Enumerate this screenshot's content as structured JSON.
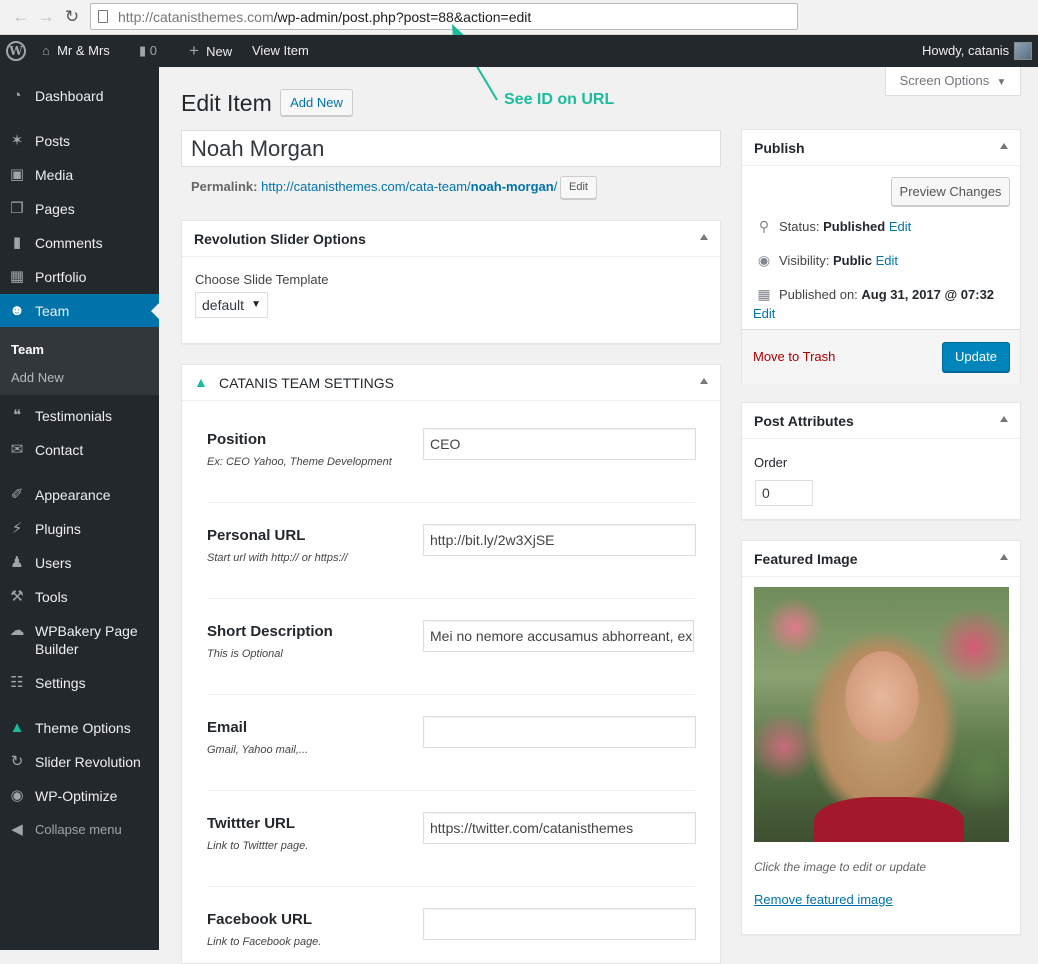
{
  "browser": {
    "url_host": "http://catanisthemes.com",
    "url_path": "/wp-admin/post.php?post=88&action=edit"
  },
  "annotation": {
    "text": "See ID on URL",
    "color": "#1abc9c"
  },
  "adminbar": {
    "site_name": "Mr & Mrs",
    "comments_count": "0",
    "new_label": "New",
    "view_label": "View Item",
    "howdy": "Howdy, catanis"
  },
  "sidebar": {
    "items": [
      {
        "label": "Dashboard",
        "icon": "dashboard-icon"
      },
      {
        "label": "Posts",
        "icon": "pin-icon"
      },
      {
        "label": "Media",
        "icon": "media-icon"
      },
      {
        "label": "Pages",
        "icon": "pages-icon"
      },
      {
        "label": "Comments",
        "icon": "comment-icon"
      },
      {
        "label": "Portfolio",
        "icon": "grid-icon"
      },
      {
        "label": "Team",
        "icon": "team-icon"
      },
      {
        "label": "Testimonials",
        "icon": "quote-icon"
      },
      {
        "label": "Contact",
        "icon": "mail-icon"
      },
      {
        "label": "Appearance",
        "icon": "brush-icon"
      },
      {
        "label": "Plugins",
        "icon": "plugin-icon"
      },
      {
        "label": "Users",
        "icon": "user-icon"
      },
      {
        "label": "Tools",
        "icon": "wrench-icon"
      },
      {
        "label": "WPBakery Page Builder",
        "icon": "bakery-icon"
      },
      {
        "label": "Settings",
        "icon": "settings-icon"
      },
      {
        "label": "Theme Options",
        "icon": "cat-icon"
      },
      {
        "label": "Slider Revolution",
        "icon": "refresh-icon"
      },
      {
        "label": "WP-Optimize",
        "icon": "optimize-icon"
      }
    ],
    "submenu": [
      "Team",
      "Add New"
    ],
    "collapse": "Collapse menu"
  },
  "header": {
    "title": "Edit Item",
    "add_new": "Add New",
    "screen_options": "Screen Options"
  },
  "post": {
    "title": "Noah Morgan",
    "permalink_label": "Permalink:",
    "permalink_base": "http://catanisthemes.com/cata-team/",
    "permalink_slug": "noah-morgan",
    "permalink_end": "/",
    "edit": "Edit"
  },
  "revslider": {
    "title": "Revolution Slider Options",
    "template_label": "Choose Slide Template",
    "template_value": "default"
  },
  "team_settings": {
    "title": "CATANIS TEAM SETTINGS",
    "fields": [
      {
        "label": "Position",
        "desc": "Ex: CEO Yahoo, Theme Development",
        "value": "CEO"
      },
      {
        "label": "Personal URL",
        "desc": "Start url with http:// or https://",
        "value": "http://bit.ly/2w3XjSE"
      },
      {
        "label": "Short Description",
        "desc": "This is Optional",
        "value": "Mei no nemore accusamus abhorreant, ex"
      },
      {
        "label": "Email",
        "desc": "Gmail, Yahoo mail,...",
        "value": ""
      },
      {
        "label": "Twittter URL",
        "desc": "Link to Twittter page.",
        "value": "https://twitter.com/catanisthemes"
      },
      {
        "label": "Facebook URL",
        "desc": "Link to Facebook page.",
        "value": ""
      }
    ]
  },
  "publish": {
    "title": "Publish",
    "preview": "Preview Changes",
    "status_label": "Status:",
    "status_value": "Published",
    "visibility_label": "Visibility:",
    "visibility_value": "Public",
    "published_label": "Published on:",
    "published_value": "Aug 31, 2017 @ 07:32",
    "edit": "Edit",
    "trash": "Move to Trash",
    "update": "Update"
  },
  "attributes": {
    "title": "Post Attributes",
    "order_label": "Order",
    "order_value": "0"
  },
  "featured": {
    "title": "Featured Image",
    "hint": "Click the image to edit or update",
    "remove": "Remove featured image"
  }
}
